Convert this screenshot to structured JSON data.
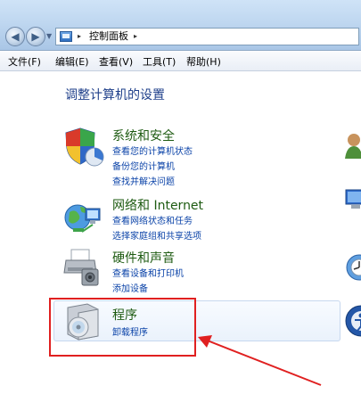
{
  "address_bar": {
    "breadcrumb": "控制面板",
    "separator": "▸"
  },
  "menu": [
    "文件(F)",
    "编辑(E)",
    "查看(V)",
    "工具(T)",
    "帮助(H)"
  ],
  "heading": "调整计算机的设置",
  "categories": [
    {
      "title": "系统和安全",
      "icon": "shield-icon",
      "links": [
        "查看您的计算机状态",
        "备份您的计算机",
        "查找并解决问题"
      ]
    },
    {
      "title": "网络和 Internet",
      "icon": "network-globe-icon",
      "links": [
        "查看网络状态和任务",
        "选择家庭组和共享选项"
      ]
    },
    {
      "title": "硬件和声音",
      "icon": "printer-icon",
      "links": [
        "查看设备和打印机",
        "添加设备"
      ]
    },
    {
      "title": "程序",
      "icon": "programs-disc-icon",
      "links": [
        "卸载程序"
      ]
    }
  ],
  "colors": {
    "annotation": "#e02020",
    "link": "#0b43a8",
    "category_title": "#1e5b12",
    "heading": "#1e3f8a"
  }
}
